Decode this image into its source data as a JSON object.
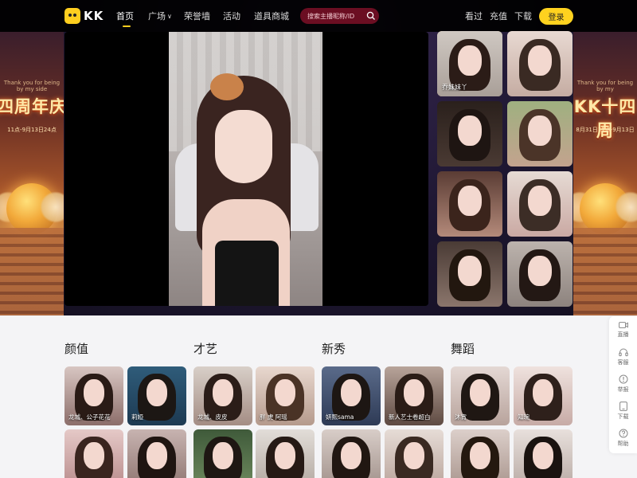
{
  "nav": {
    "logo": "KK",
    "items": [
      {
        "label": "首页"
      },
      {
        "label": "广场"
      },
      {
        "label": "荣誉墙"
      },
      {
        "label": "活动"
      },
      {
        "label": "道具商城"
      }
    ],
    "search_placeholder": "搜索主播昵称/ID",
    "right": [
      {
        "label": "看过"
      },
      {
        "label": "充值"
      },
      {
        "label": "下载"
      }
    ],
    "login_label": "登录"
  },
  "banner": {
    "left_title": "四周年庆",
    "left_small": "Thank you for being by my side",
    "left_date": "11点-9月13日24点",
    "right_title": "KK十四周",
    "right_small": "Thank you for being by my",
    "right_date": "8月31日11点-9月13日"
  },
  "hero_thumbs": [
    {
      "label": "乔妹妹丫",
      "active": true
    },
    {
      "label": ""
    },
    {
      "label": ""
    },
    {
      "label": ""
    },
    {
      "label": ""
    },
    {
      "label": ""
    },
    {
      "label": ""
    },
    {
      "label": ""
    }
  ],
  "categories": [
    {
      "title": "颜值",
      "cards": [
        {
          "label": "龙城、公子花花"
        },
        {
          "label": "莉婭"
        },
        {
          "label": ""
        },
        {
          "label": ""
        }
      ]
    },
    {
      "title": "才艺",
      "cards": [
        {
          "label": "龙城、皮皮"
        },
        {
          "label": "胖 虎 阿瑶"
        },
        {
          "label": ""
        },
        {
          "label": ""
        }
      ]
    },
    {
      "title": "新秀",
      "cards": [
        {
          "label": "妍熙sama"
        },
        {
          "label": "新人艺士卷超白"
        },
        {
          "label": ""
        },
        {
          "label": ""
        }
      ]
    },
    {
      "title": "舞蹈",
      "cards": [
        {
          "label": "沐宵"
        },
        {
          "label": "知琬"
        },
        {
          "label": ""
        },
        {
          "label": ""
        }
      ]
    }
  ],
  "tools": [
    {
      "label": "直播",
      "icon": "camera-icon"
    },
    {
      "label": "客服",
      "icon": "headset-icon"
    },
    {
      "label": "举报",
      "icon": "report-icon"
    },
    {
      "label": "下载",
      "icon": "download-icon"
    },
    {
      "label": "帮助",
      "icon": "help-icon"
    }
  ]
}
